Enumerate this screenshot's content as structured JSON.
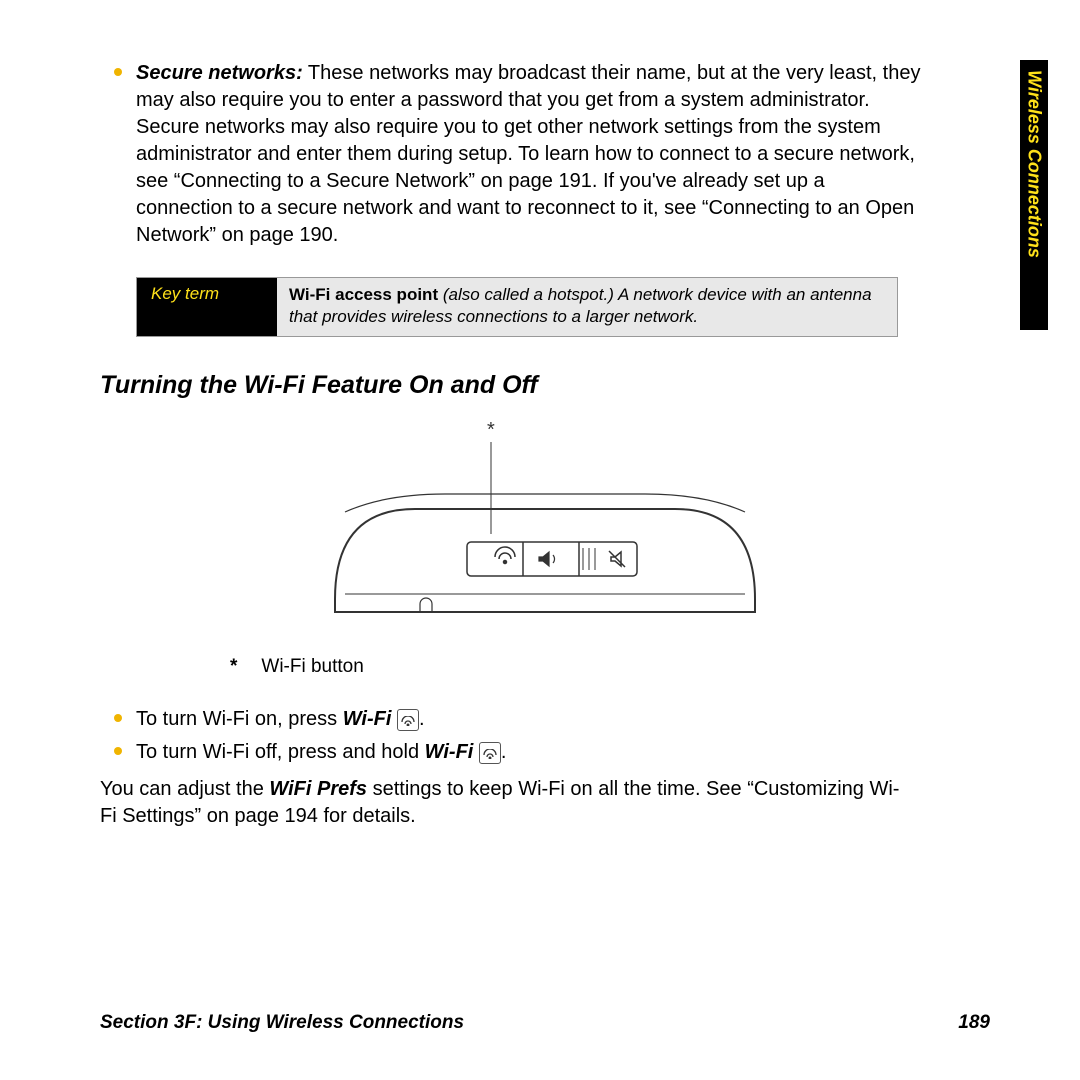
{
  "side_tab": "Wireless Connections",
  "bullets_top": {
    "title": "Secure networks:",
    "text": " These networks may broadcast their name, but at the very least, they may also require you to enter a password that you get from a system administrator. Secure networks may also require you to get other network settings from the system administrator and enter them during setup. To learn how to connect to a secure network, see “Connecting to a Secure Network” on page 191. If you've already set up a connection to a secure network and want to reconnect to it, see “Connecting to an Open Network” on page 190."
  },
  "keyterm": {
    "label": "Key term",
    "bold": "Wi-Fi access point",
    "rest": " (also called a hotspot.) A network device with an antenna that provides wireless connections to a larger network."
  },
  "section_title": "Turning the Wi-Fi Feature On and Off",
  "legend": {
    "star": "*",
    "text": "Wi-Fi button"
  },
  "list2": {
    "on": {
      "pre": "To turn Wi-Fi on, press ",
      "em": "Wi-Fi",
      "post": " "
    },
    "off": {
      "pre": "To turn Wi-Fi off, press and hold ",
      "em": "Wi-Fi",
      "post": " "
    }
  },
  "body2": {
    "pre": "You can adjust the ",
    "em": "WiFi Prefs",
    "post": " settings to keep Wi-Fi on all the time. See “Customizing Wi-Fi Settings” on page 194 for details."
  },
  "footer": {
    "left": "Section 3F: Using Wireless Connections",
    "right": "189"
  }
}
